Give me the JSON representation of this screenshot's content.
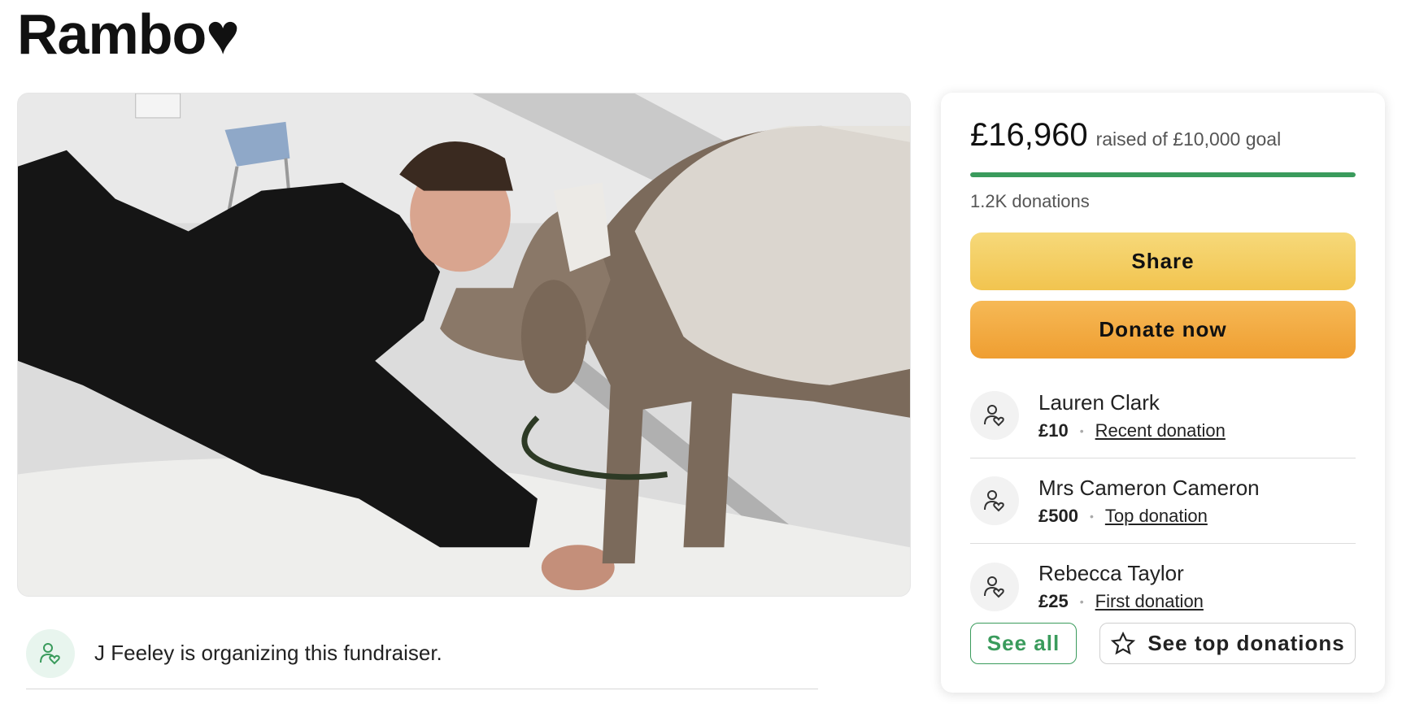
{
  "page": {
    "title": "Rambo♥"
  },
  "organizer": {
    "text": "J Feeley is organizing this fundraiser."
  },
  "card": {
    "amount": "£16,960",
    "goal_text": "raised of £10,000 goal",
    "progress_fraction": 1.0,
    "donations_count": "1.2K donations",
    "share_label": "Share",
    "donate_label": "Donate now",
    "donors": [
      {
        "name": "Lauren Clark",
        "amount": "£10",
        "tag": "Recent donation"
      },
      {
        "name": "Mrs Cameron Cameron",
        "amount": "£500",
        "tag": "Top donation"
      },
      {
        "name": "Rebecca Taylor",
        "amount": "£25",
        "tag": "First donation"
      }
    ],
    "see_all_label": "See all",
    "see_top_label": "See top donations"
  },
  "colors": {
    "accent_green": "#3a9b5c",
    "share_yellow": "#f2c44f",
    "donate_orange": "#ef9e31"
  },
  "icons": {
    "donor_avatar": "person-heart-icon",
    "top_donations": "star-icon"
  }
}
